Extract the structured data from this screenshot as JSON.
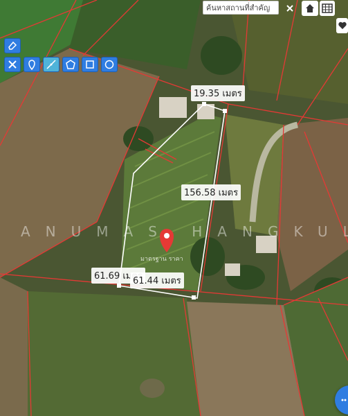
{
  "search": {
    "placeholder": "ค้นหาสถานที่สำคัญ"
  },
  "watermark": "ANUMAS HANGKUL",
  "pin_label": "มาตรฐาน ราคา",
  "measurements": {
    "top_edge": "19.35 เมตร",
    "right_edge": "156.58 เมตร",
    "bottom_left": "61.69 เมตร",
    "bottom_edge": "61.44 เมตร"
  },
  "toolbar": {
    "eraser": "eraser-icon",
    "clear": "clear-tools-icon",
    "marker": "marker-icon",
    "line": "line-tool-icon",
    "polygon": "polygon-tool-icon",
    "rectangle": "rectangle-tool-icon",
    "circle": "circle-tool-icon"
  },
  "colors": {
    "boundary": "#e53935",
    "selected_parcel": "#ffffff",
    "pin": "#e53935",
    "tool_button": "#2f7de1"
  }
}
